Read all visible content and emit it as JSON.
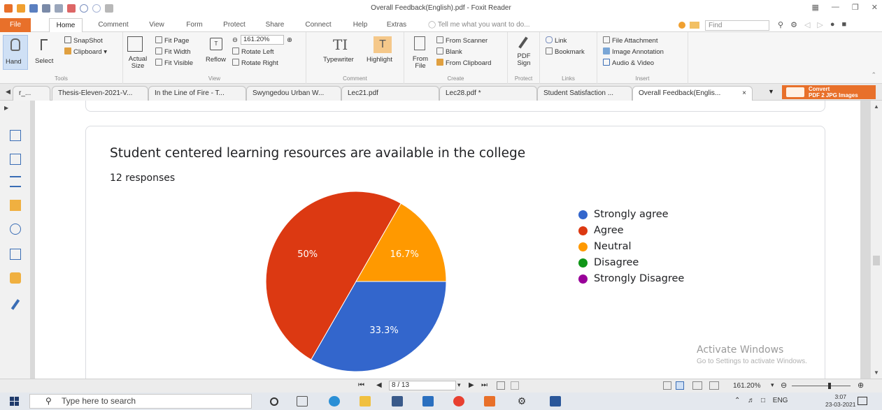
{
  "window": {
    "title": "Overall Feedback(English).pdf - Foxit Reader"
  },
  "ribbon_tabs": [
    "File",
    "Home",
    "Comment",
    "View",
    "Form",
    "Protect",
    "Share",
    "Connect",
    "Help",
    "Extras"
  ],
  "tell_me_placeholder": "Tell me what you want to do...",
  "find_placeholder": "Find",
  "ribbon": {
    "tools": {
      "hand": "Hand",
      "select": "Select",
      "snapshot": "SnapShot",
      "clipboard": "Clipboard",
      "group": "Tools"
    },
    "view": {
      "actual_size": "Actual Size",
      "fit_page": "Fit Page",
      "fit_width": "Fit Width",
      "fit_visible": "Fit Visible",
      "reflow": "Reflow",
      "zoom_value": "161.20%",
      "rotate_left": "Rotate Left",
      "rotate_right": "Rotate Right",
      "group": "View"
    },
    "comment": {
      "typewriter": "Typewriter",
      "highlight": "Highlight",
      "group": "Comment"
    },
    "create": {
      "from_file": "From File",
      "from_scanner": "From Scanner",
      "blank": "Blank",
      "from_clipboard": "From Clipboard",
      "group": "Create"
    },
    "protect": {
      "pdf_sign": "PDF Sign",
      "group": "Protect"
    },
    "links": {
      "link": "Link",
      "bookmark": "Bookmark",
      "group": "Links"
    },
    "insert": {
      "file_attachment": "File Attachment",
      "image_annotation": "Image Annotation",
      "audio_video": "Audio & Video",
      "group": "Insert"
    }
  },
  "doc_tabs": [
    {
      "label": "r_..."
    },
    {
      "label": "Thesis-Eleven-2021-V..."
    },
    {
      "label": "In the Line of Fire - T..."
    },
    {
      "label": "Swyngedou Urban W..."
    },
    {
      "label": "Lec21.pdf"
    },
    {
      "label": "Lec28.pdf *"
    },
    {
      "label": "Student Satisfaction ..."
    },
    {
      "label": "Overall Feedback(Englis...",
      "close": "×"
    }
  ],
  "convert_ad": {
    "line1": "Convert",
    "line2": "PDF 2 JPG Images"
  },
  "question": {
    "title": "Student centered learning resources are available in the college",
    "responses": "12 responses"
  },
  "chart_data": {
    "type": "pie",
    "categories": [
      "Strongly agree",
      "Agree",
      "Neutral",
      "Disagree",
      "Strongly Disagree"
    ],
    "values": [
      33.3,
      50,
      16.7,
      0,
      0
    ],
    "value_labels": [
      "33.3%",
      "50%",
      "16.7%",
      "",
      ""
    ],
    "colors": [
      "#3366cc",
      "#dc3912",
      "#ff9900",
      "#109618",
      "#990099"
    ],
    "legend": "right"
  },
  "watermark": {
    "title": "Activate Windows",
    "subtitle": "Go to Settings to activate Windows."
  },
  "statusbar": {
    "page_value": "8 / 13",
    "zoom": "161.20%"
  },
  "taskbar": {
    "search_placeholder": "Type here to search",
    "lang": "ENG",
    "time": "3:07",
    "date": "23-03-2021"
  }
}
